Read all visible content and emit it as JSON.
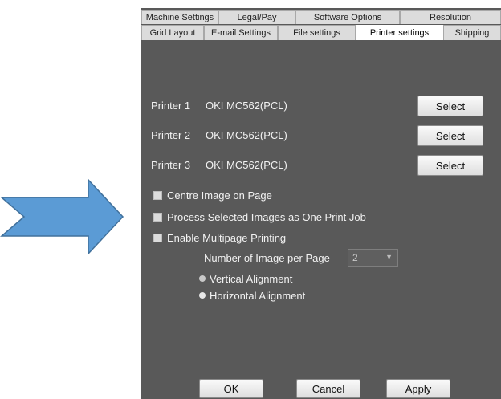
{
  "tabs_row1": [
    {
      "label": "Machine Settings",
      "active": false
    },
    {
      "label": "Legal/Pay",
      "active": false
    },
    {
      "label": "Software Options",
      "active": false
    },
    {
      "label": "Resolution",
      "active": false
    }
  ],
  "tabs_row2": [
    {
      "label": "Grid Layout",
      "active": false
    },
    {
      "label": "E-mail Settings",
      "active": false
    },
    {
      "label": "File settings",
      "active": false
    },
    {
      "label": "Printer settings",
      "active": true
    },
    {
      "label": "Shipping",
      "active": false
    }
  ],
  "printers": [
    {
      "label": "Printer 1",
      "name": "OKI MC562(PCL)",
      "button": "Select"
    },
    {
      "label": "Printer 2",
      "name": "OKI MC562(PCL)",
      "button": "Select"
    },
    {
      "label": "Printer 3",
      "name": "OKI MC562(PCL)",
      "button": "Select"
    }
  ],
  "options": {
    "centre_image": "Centre Image on Page",
    "one_print_job": "Process Selected Images as One Print Job",
    "multipage": "Enable Multipage Printing"
  },
  "multipage": {
    "count_label": "Number of Image per Page",
    "count_value": "2",
    "vertical": "Vertical  Alignment",
    "horizontal": "Horizontal Alignment"
  },
  "footer": {
    "ok": "OK",
    "cancel": "Cancel",
    "apply": "Apply"
  },
  "colors": {
    "panel": "#595959",
    "arrow_fill": "#5b9bd5",
    "arrow_stroke": "#41719c"
  }
}
